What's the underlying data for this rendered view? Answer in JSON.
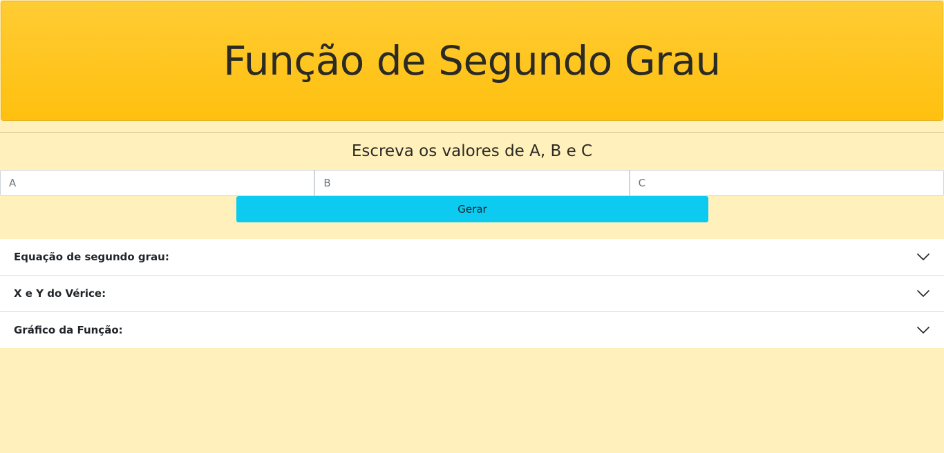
{
  "header": {
    "title": "Função de Segundo Grau"
  },
  "form": {
    "subtitle": "Escreva os valores de A, B e C",
    "inputs": [
      {
        "placeholder": "A",
        "value": ""
      },
      {
        "placeholder": "B",
        "value": ""
      },
      {
        "placeholder": "C",
        "value": ""
      }
    ],
    "submit_label": "Gerar"
  },
  "accordion": {
    "items": [
      {
        "label": "Equação de segundo grau:",
        "icon": "chevron-down-icon"
      },
      {
        "label": "X e Y do Vérice:",
        "icon": "chevron-down-icon"
      },
      {
        "label": "Gráfico da Função:",
        "icon": "chevron-down-icon"
      }
    ]
  },
  "colors": {
    "background": "#fff0bc",
    "header": "#ffc107",
    "button": "#0dcaf0"
  }
}
